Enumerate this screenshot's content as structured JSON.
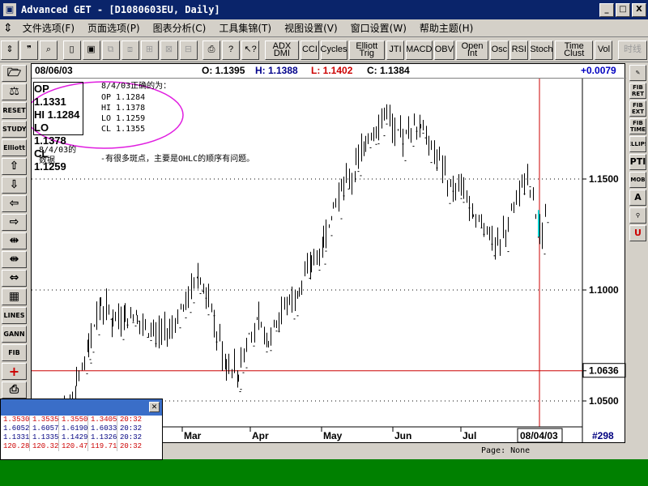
{
  "window": {
    "title": "Advanced GET - [D1080603EU, Daily]",
    "buttons": [
      "_",
      "□",
      "X"
    ]
  },
  "menu": [
    "文件选项(F)",
    "页面选项(P)",
    "图表分析(C)",
    "工具集锦(T)",
    "视图设置(V)",
    "窗口设置(W)",
    "帮助主题(H)"
  ],
  "toolbar": {
    "tools": [
      "ADX DMI",
      "CCI",
      "Cycles",
      "Elliott Trig",
      "JTI",
      "MACD",
      "OBV",
      "Open Int",
      "Osc",
      "RSI",
      "Stoch",
      "Time Clust",
      "Vol"
    ],
    "timeframe": "时线"
  },
  "quote_header": {
    "date": "08/06/03",
    "open": "O: 1.1395",
    "high": "H: 1.1388",
    "low": "L: 1.1402",
    "close": "C: 1.1384",
    "change": "+0.0079"
  },
  "annotation": {
    "box": {
      "op": "OP 1.1331",
      "hi": "HI  1.1284",
      "lo": "LO 1.1378",
      "cl": "CL  1.1259"
    },
    "correct_title": "8/4/03正确的为：",
    "correct_lines": [
      "OP 1.1284",
      "HI 1.1378",
      "LO 1.1259",
      "CL 1.1355"
    ],
    "date_note": [
      "8/4/03的",
      "数据"
    ],
    "problem_note": "-有很多斑点，主要是OHLC的顺序有问题。"
  },
  "price_axis": {
    "labels": [
      "1.1500",
      "1.1000",
      "1.0636",
      "1.0500"
    ]
  },
  "time_axis": {
    "months": [
      "Mar",
      "Apr",
      "May",
      "Jun",
      "Jul"
    ],
    "cursor_date": "08/04/03",
    "bar_number": "#298"
  },
  "status": {
    "page": "Page: None"
  },
  "quote_table": [
    [
      "1.3530",
      "1.3535",
      "1.3550",
      "1.3405",
      "20:32"
    ],
    [
      "1.6052",
      "1.6057",
      "1.6190",
      "1.6033",
      "20:32"
    ],
    [
      "1.1331",
      "1.1335",
      "1.1429",
      "1.1326",
      "20:32"
    ],
    [
      "120.28",
      "120.32",
      "120.47",
      "119.71",
      "20:32"
    ]
  ],
  "left_tools": [
    "folder",
    "scales",
    "RESET",
    "STUDY",
    "Elliott",
    "up",
    "down",
    "left",
    "right",
    "compress",
    "expand",
    "zoom",
    "grid",
    "LINES",
    "GANN",
    "FIB",
    "cross",
    "print"
  ],
  "right_tools": [
    "pencil",
    "FIB RET",
    "FIB EXT",
    "FIB TIME",
    "ELLIPS",
    "PTI",
    "MOB",
    "A",
    "zoom",
    "U"
  ]
}
